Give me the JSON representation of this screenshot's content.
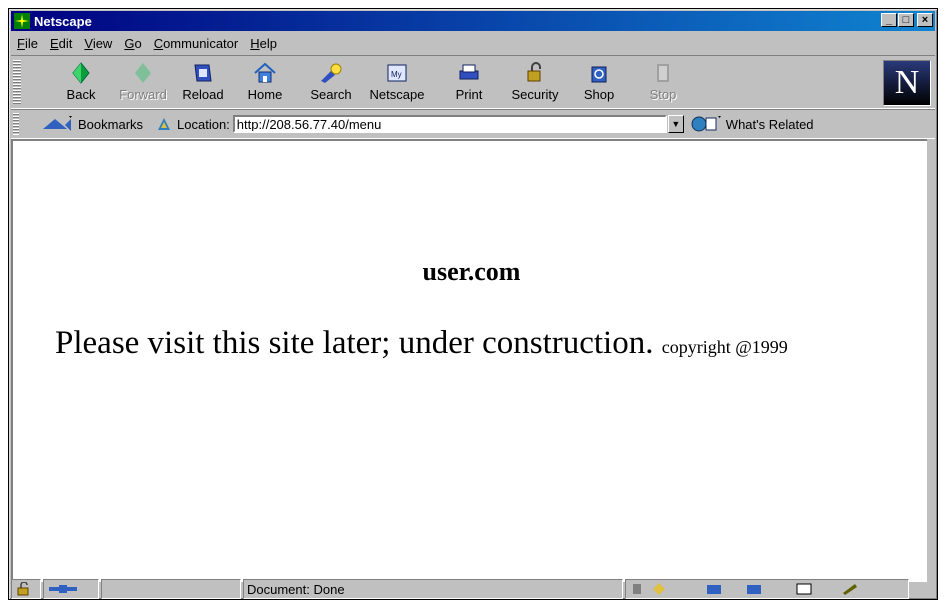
{
  "window": {
    "title": "Netscape"
  },
  "menu": [
    "File",
    "Edit",
    "View",
    "Go",
    "Communicator",
    "Help"
  ],
  "menu_underline": [
    "F",
    "E",
    "V",
    "G",
    "C",
    "H"
  ],
  "toolbar": {
    "back": "Back",
    "forward": "Forward",
    "reload": "Reload",
    "home": "Home",
    "search": "Search",
    "netscape": "Netscape",
    "print": "Print",
    "security": "Security",
    "shop": "Shop",
    "stop": "Stop",
    "logo": "N"
  },
  "location": {
    "bookmarks_label": "Bookmarks",
    "location_label": "Location:",
    "url": "http://208.56.77.40/menu",
    "related_label": "What's Related"
  },
  "page": {
    "heading": "user.com",
    "message": "Please visit this site later; under construction.",
    "copyright": "copyright @1999"
  },
  "status": {
    "text": "Document: Done"
  },
  "colors": {
    "titlebar": "#000080",
    "chrome": "#c0c0c0"
  }
}
